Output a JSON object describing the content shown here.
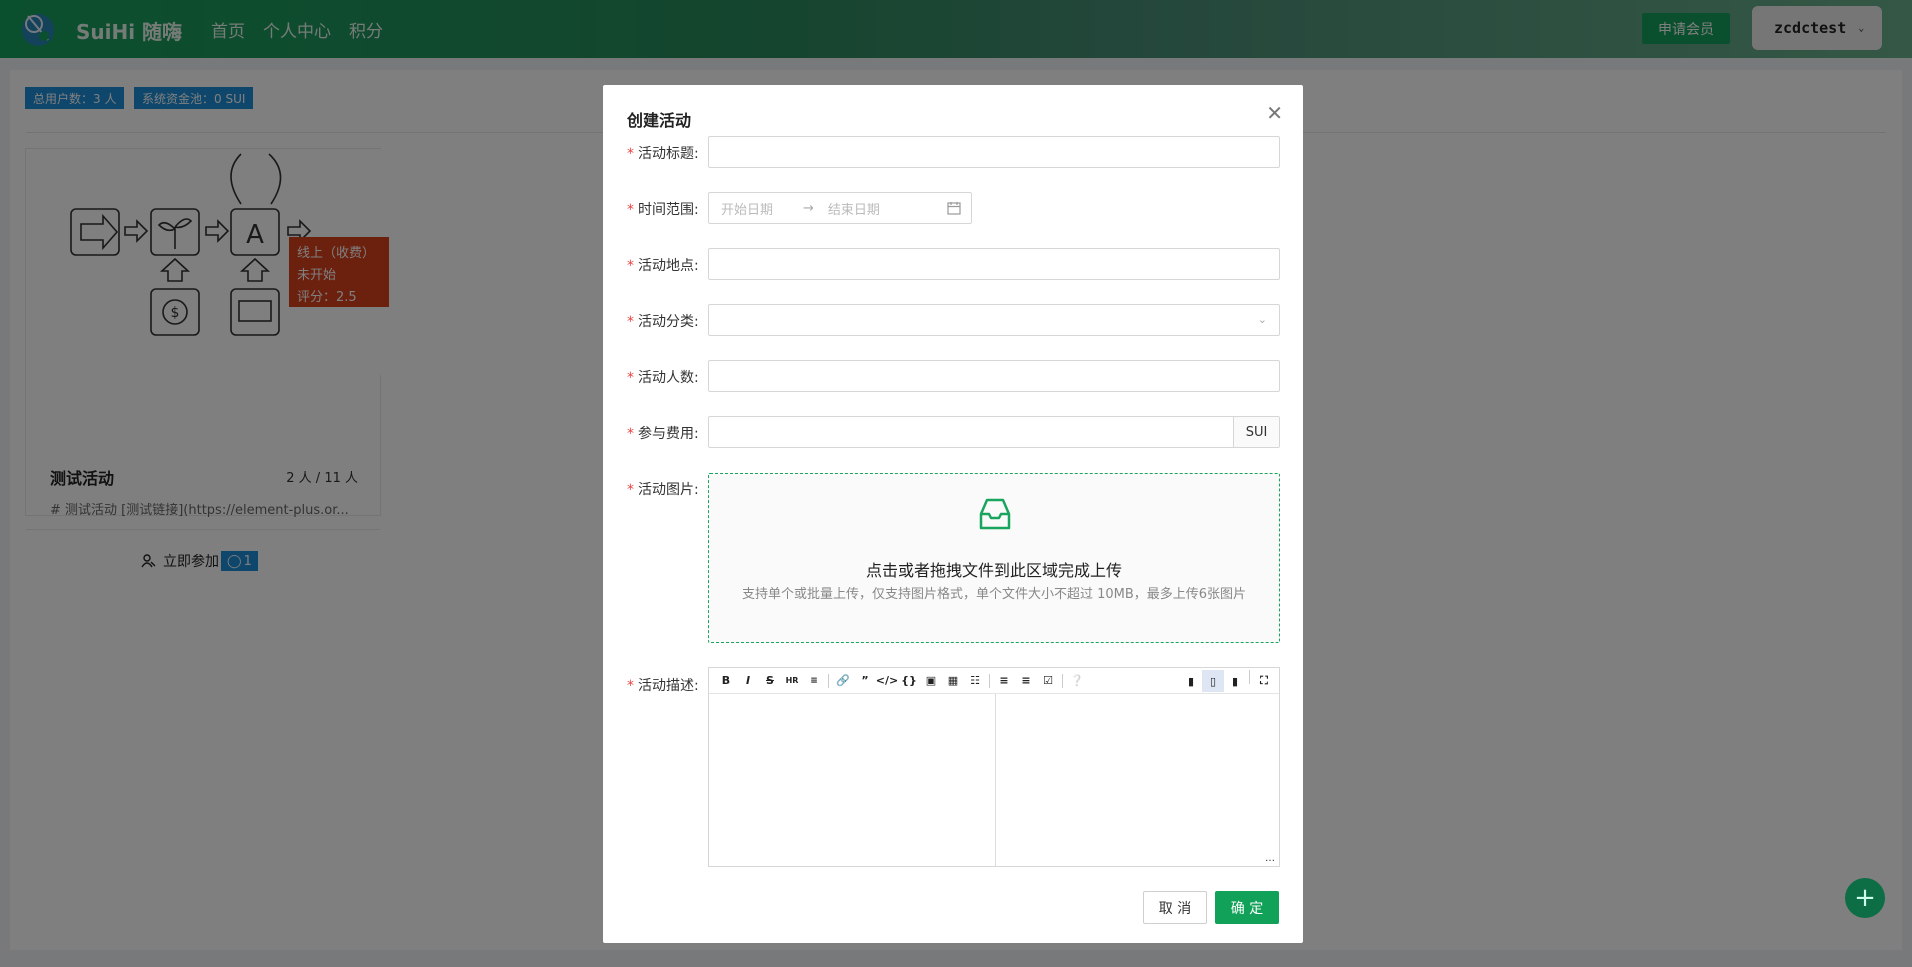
{
  "header": {
    "brand": "SuiHi 随嗨",
    "nav": [
      "首页",
      "个人中心",
      "积分"
    ],
    "member_button": "申请会员",
    "username": "zcdctest"
  },
  "stats": {
    "users": "总用户数：3 人",
    "pool": "系统资金池：0 SUI"
  },
  "card": {
    "tag_line1": "线上（收费）",
    "tag_line2": "未开始",
    "tag_line3": "评分：2.5",
    "title": "测试活动",
    "count": "2 人 / 11 人",
    "desc": "# 测试活动 [测试链接](https://element-plus.or...",
    "join_label": "立即参加",
    "join_badge": "1"
  },
  "dialog": {
    "title": "创建活动",
    "fields": {
      "title_label": "活动标题:",
      "time_label": "时间范围:",
      "start_placeholder": "开始日期",
      "end_placeholder": "结束日期",
      "location_label": "活动地点:",
      "category_label": "活动分类:",
      "people_label": "活动人数:",
      "fee_label": "参与费用:",
      "fee_unit": "SUI",
      "image_label": "活动图片:",
      "desc_label": "活动描述:"
    },
    "upload": {
      "text": "点击或者拖拽文件到此区域完成上传",
      "hint": "支持单个或批量上传，仅支持图片格式，单个文件大小不超过 10MB，最多上传6张图片"
    },
    "cancel": "取 消",
    "ok": "确 定"
  },
  "colors": {
    "primary": "#11a158",
    "badge_blue": "#1c8ed6",
    "tag_red": "#d9401d",
    "required": "#e84545"
  }
}
